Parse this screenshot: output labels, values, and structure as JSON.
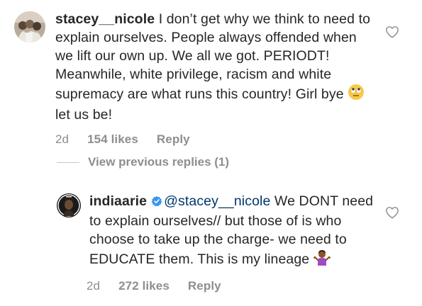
{
  "comments": [
    {
      "username": "stacey__nicole",
      "text_before_emoji": " I don’t get why we think to need to explain ourselves. People always offended when we lift our own up. We all we got. PERIODT! Meanwhile, white privilege, racism and white supremacy are what runs this country! Girl bye ",
      "emoji": "face-with-rolling-eyes",
      "text_after_emoji": " let us be!",
      "time": "2d",
      "likes": "154 likes",
      "reply_label": "Reply"
    },
    {
      "username": "indiaarie",
      "verified": true,
      "mention": "@stacey__nicole",
      "text_before_emoji": "  We DONT need to explain ourselves// but those of is who choose to take up the charge- we need to EDUCATE them.  This is my lineage ",
      "emoji": "person-shrugging",
      "time": "2d",
      "likes": "272 likes",
      "reply_label": "Reply"
    }
  ],
  "view_replies_label": "View previous replies (1)",
  "icons": {
    "like": "heart-outline-icon",
    "verified": "verified-badge-icon"
  },
  "colors": {
    "text": "#262626",
    "secondary": "#8e8e8e",
    "mention": "#00376b",
    "verified": "#3897f0"
  }
}
